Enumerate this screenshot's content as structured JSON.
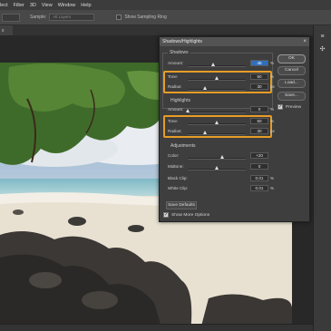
{
  "menubar": {
    "items": [
      "elect",
      "Filter",
      "3D",
      "View",
      "Window",
      "Help"
    ]
  },
  "options_bar": {
    "sample_label": "Sample:",
    "sample_value": "All Layers",
    "show_sampling_ring": "Show Sampling Ring"
  },
  "dialog": {
    "title": "Shadows/Highlights",
    "shadows": {
      "group": "Shadows",
      "amount_label": "Amount:",
      "amount_value": "45",
      "amount_unit": "%",
      "amount_level": 0.45,
      "tone_label": "Tone:",
      "tone_value": "50",
      "tone_unit": "%",
      "tone_level": 0.5,
      "radius_label": "Radius:",
      "radius_value": "30",
      "radius_unit": "px",
      "radius_level": 0.3
    },
    "highlights": {
      "group": "Highlights",
      "amount_label": "Amount:",
      "amount_value": "0",
      "amount_unit": "%",
      "amount_level": 0.0,
      "tone_label": "Tone:",
      "tone_value": "50",
      "tone_unit": "%",
      "tone_level": 0.5,
      "radius_label": "Radius:",
      "radius_value": "30",
      "radius_unit": "px",
      "radius_level": 0.3
    },
    "adjustments": {
      "group": "Adjustments",
      "color_label": "Color:",
      "color_value": "+20",
      "color_level": 0.6,
      "midtone_label": "Midtone:",
      "midtone_value": "0",
      "midtone_level": 0.5,
      "black_clip_label": "Black Clip:",
      "black_clip_value": "0.01",
      "black_clip_unit": "%",
      "white_clip_label": "White Clip:",
      "white_clip_value": "0.01",
      "white_clip_unit": "%"
    },
    "save_defaults": "Save Defaults",
    "show_more_options": "Show More Options",
    "buttons": {
      "ok": "OK",
      "cancel": "Cancel",
      "load": "Load...",
      "save": "Save..."
    },
    "preview": "Preview",
    "close_glyph": "×"
  },
  "tab": {
    "label": "x"
  },
  "colors": {
    "highlight": "#e79c26",
    "ui_bg": "#2b2b2b",
    "dialog_bg": "#3e3e3e"
  }
}
